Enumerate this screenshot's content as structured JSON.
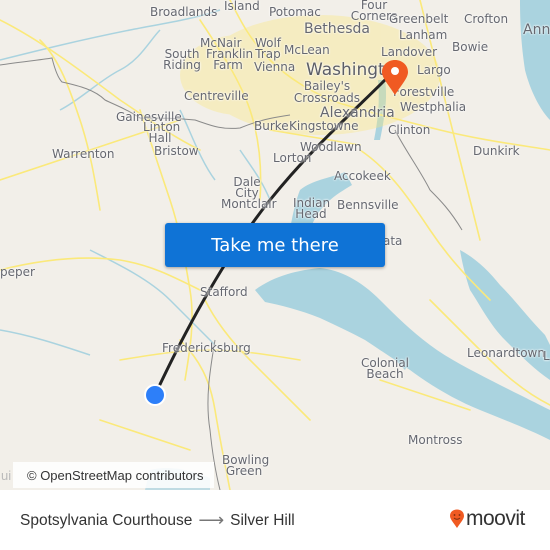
{
  "map": {
    "labels": [
      {
        "id": "broadlands",
        "text": "Broadlands"
      },
      {
        "id": "island",
        "text": "Island"
      },
      {
        "id": "potomac",
        "text": "Potomac"
      },
      {
        "id": "four-corners",
        "text": "Four Corners"
      },
      {
        "id": "bethesda",
        "text": "Bethesda"
      },
      {
        "id": "greenbelt",
        "text": "Greenbelt"
      },
      {
        "id": "crofton",
        "text": "Crofton"
      },
      {
        "id": "annapolis",
        "text": "Ann"
      },
      {
        "id": "mcnair",
        "text": "McNair"
      },
      {
        "id": "wolf-trap",
        "text": "Wolf Trap"
      },
      {
        "id": "mclean",
        "text": "McLean"
      },
      {
        "id": "lanham",
        "text": "Lanham"
      },
      {
        "id": "south-riding",
        "text": "South Riding"
      },
      {
        "id": "franklin-farm",
        "text": "Franklin Farm"
      },
      {
        "id": "vienna",
        "text": "Vienna"
      },
      {
        "id": "landover",
        "text": "Landover"
      },
      {
        "id": "bowie",
        "text": "Bowie"
      },
      {
        "id": "washington",
        "text": "Washington"
      },
      {
        "id": "largo",
        "text": "Largo"
      },
      {
        "id": "centreville",
        "text": "Centreville"
      },
      {
        "id": "baileys-crossroads",
        "text": "Bailey's Crossroads"
      },
      {
        "id": "forestville",
        "text": "Forestville"
      },
      {
        "id": "westphalia",
        "text": "Westphalia"
      },
      {
        "id": "alexandria",
        "text": "Alexandria"
      },
      {
        "id": "gainesville",
        "text": "Gainesville"
      },
      {
        "id": "linton-hall",
        "text": "Linton Hall"
      },
      {
        "id": "burke",
        "text": "Burke"
      },
      {
        "id": "kingstowne",
        "text": "Kingstowne"
      },
      {
        "id": "clinton",
        "text": "Clinton"
      },
      {
        "id": "woodlawn",
        "text": "Woodlawn"
      },
      {
        "id": "bristow",
        "text": "Bristow"
      },
      {
        "id": "warrenton",
        "text": "Warrenton"
      },
      {
        "id": "lorton",
        "text": "Lorton"
      },
      {
        "id": "dunkirk",
        "text": "Dunkirk"
      },
      {
        "id": "accokeek",
        "text": "Accokeek"
      },
      {
        "id": "dale-city",
        "text": "Dale City"
      },
      {
        "id": "montclair",
        "text": "Montclair"
      },
      {
        "id": "indian-head",
        "text": "Indian Head"
      },
      {
        "id": "bennsville",
        "text": "Bennsville"
      },
      {
        "id": "culpeper",
        "text": "peper"
      },
      {
        "id": "waldorf-partial",
        "text": "ata"
      },
      {
        "id": "stafford",
        "text": "Stafford"
      },
      {
        "id": "fredericksburg",
        "text": "Fredericksburg"
      },
      {
        "id": "leonardtown",
        "text": "Leonardtown"
      },
      {
        "id": "leonardtown-partial",
        "text": "L"
      },
      {
        "id": "colonial-beach",
        "text": "Colonial Beach"
      },
      {
        "id": "montross",
        "text": "Montross"
      },
      {
        "id": "bowling-green",
        "text": "Bowling Green"
      }
    ],
    "origin_marker": {
      "name": "Spotsylvania Courthouse",
      "color": "#2d7ff9"
    },
    "destination_marker": {
      "name": "Silver Hill",
      "color": "#f05a22"
    },
    "route_line_color": "#222222",
    "water_color": "#aad3df",
    "road_color": "#fbe97a",
    "cta_label": "Take me there",
    "attribution": "© OpenStreetMap contributors",
    "attribution_cut": "ui"
  },
  "footer": {
    "origin": "Spotsylvania Courthouse",
    "arrow": "⟶",
    "destination": "Silver Hill",
    "brand": "moovit",
    "brand_color": "#f05a22"
  }
}
